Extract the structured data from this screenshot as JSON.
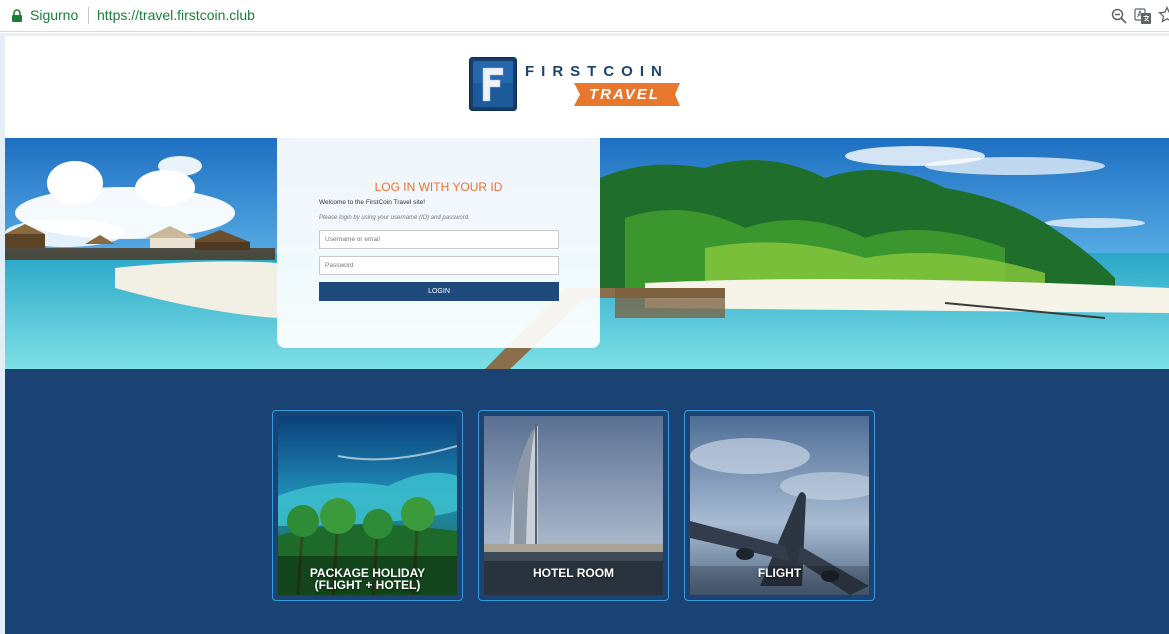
{
  "browser": {
    "secure_label": "Sigurno",
    "url": "https://travel.firstcoin.club",
    "icons": [
      "lock-icon",
      "zoom-icon",
      "translate-icon",
      "star-icon"
    ],
    "url_color": "#188038"
  },
  "logo": {
    "mark": "F",
    "wordmark": "FIRSTCOIN",
    "sub": "TRAVEL",
    "colors": {
      "navy": "#1b4470",
      "orange": "#e8772e"
    }
  },
  "login": {
    "title": "LOG IN WITH YOUR ID",
    "welcome": "Welcome to the FirstCoin Travel site!",
    "hint": "Please login by using your username (ID) and password.",
    "username_placeholder": "Username or email",
    "password_placeholder": "Password",
    "button_label": "LOGIN",
    "colors": {
      "title": "#e87534",
      "button": "#1f4a7c"
    }
  },
  "tiles": [
    {
      "label_line1": "PACKAGE HOLIDAY",
      "label_line2": "(FLIGHT + HOTEL)"
    },
    {
      "label_line1": "HOTEL ROOM",
      "label_line2": ""
    },
    {
      "label_line1": "FLIGHT",
      "label_line2": ""
    }
  ],
  "colors": {
    "band": "#1a4374",
    "tile_border": "#3a9ae0"
  }
}
